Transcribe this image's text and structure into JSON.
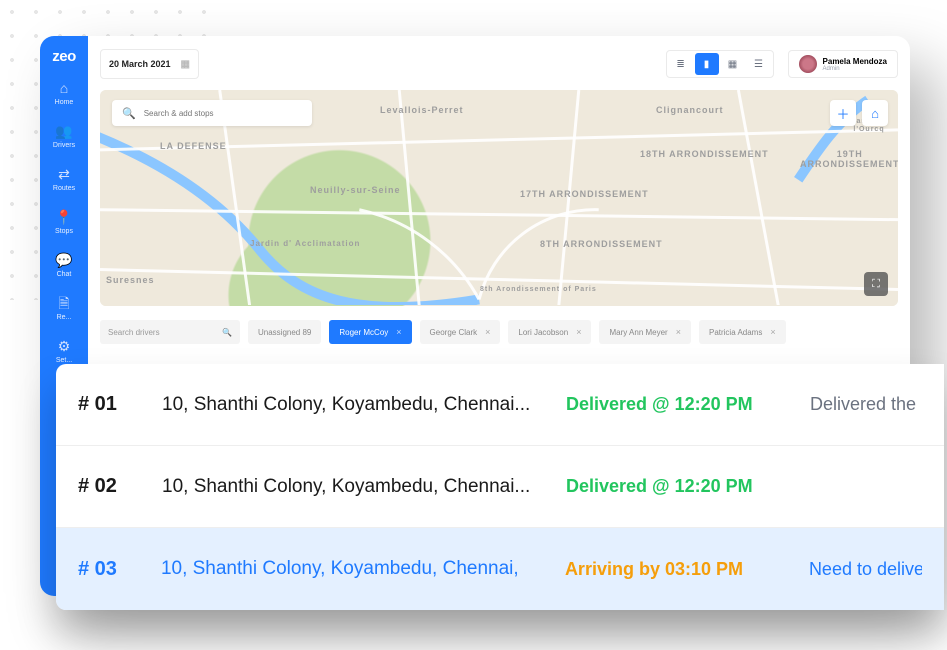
{
  "brand": "zeo",
  "date": "20 March 2021",
  "user": {
    "name": "Pamela Mendoza",
    "role": "Admin"
  },
  "nav": [
    {
      "label": "Home"
    },
    {
      "label": "Drivers"
    },
    {
      "label": "Routes"
    },
    {
      "label": "Stops"
    },
    {
      "label": "Chat"
    },
    {
      "label": "Re..."
    },
    {
      "label": "Set..."
    }
  ],
  "search": {
    "placeholder": "Search & add stops"
  },
  "map": {
    "places": [
      "LA DEFENSE",
      "Levallois-Perret",
      "Neuilly-sur-Seine",
      "Jardin d' Acclimatation",
      "Suresnes",
      "17TH ARRONDISSEMENT",
      "8TH ARRONDISSEMENT",
      "8th Arondissement of Paris",
      "Clignancourt",
      "18TH ARRONDISSEMENT",
      "19TH ARRONDISSEMENT",
      "Canal de l'Ourcq"
    ]
  },
  "driverSearch": {
    "placeholder": "Search drivers"
  },
  "drivers": [
    {
      "label": "Unassigned 89",
      "active": false
    },
    {
      "label": "Roger McCoy",
      "active": true
    },
    {
      "label": "George Clark",
      "active": false
    },
    {
      "label": "Lori Jacobson",
      "active": false
    },
    {
      "label": "Mary Ann Meyer",
      "active": false
    },
    {
      "label": "Patricia Adams",
      "active": false
    }
  ],
  "deliveries": [
    {
      "idx": "# 01",
      "addr": "10, Shanthi Colony, Koyambedu, Chennai...",
      "status": "Delivered @ 12:20 PM",
      "kind": "done",
      "note": "Delivered the"
    },
    {
      "idx": "# 02",
      "addr": "10, Shanthi Colony, Koyambedu, Chennai...",
      "status": "Delivered @ 12:20 PM",
      "kind": "done",
      "note": ""
    },
    {
      "idx": "# 03",
      "addr": "10, Shanthi Colony, Koyambedu, Chennai,",
      "status": "Arriving by 03:10 PM",
      "kind": "wait",
      "note": "Need to delive"
    }
  ]
}
